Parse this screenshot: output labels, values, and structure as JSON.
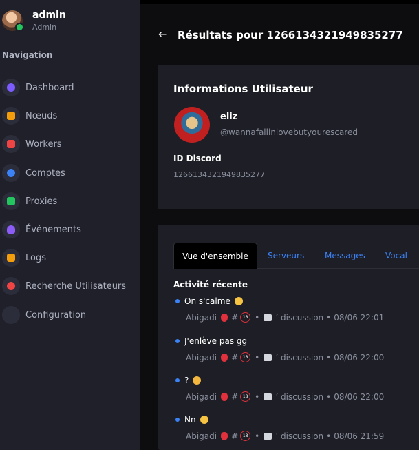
{
  "sidebar": {
    "user": {
      "name": "admin",
      "role": "Admin"
    },
    "section_title": "Navigation",
    "items": [
      {
        "label": "Dashboard",
        "icon": "dashboard-icon",
        "color": "#7c5cff"
      },
      {
        "label": "Nœuds",
        "icon": "server-icon",
        "color": "#f59e0b"
      },
      {
        "label": "Workers",
        "icon": "stack-icon",
        "color": "#ef4444"
      },
      {
        "label": "Comptes",
        "icon": "users-icon",
        "color": "#3b82f6"
      },
      {
        "label": "Proxies",
        "icon": "proxy-icon",
        "color": "#22c55e"
      },
      {
        "label": "Événements",
        "icon": "bell-icon",
        "color": "#8b5cf6"
      },
      {
        "label": "Logs",
        "icon": "log-icon",
        "color": "#f59e0b"
      },
      {
        "label": "Recherche Utilisateurs",
        "icon": "user-search-icon",
        "color": "#ef4444"
      },
      {
        "label": "Configuration",
        "icon": "gear-icon",
        "color": "#2b2d3a"
      }
    ]
  },
  "header": {
    "back_icon": "arrow-left-icon",
    "title": "Résultats pour 1266134321949835277"
  },
  "user_info": {
    "title": "Informations Utilisateur",
    "display_name": "eliz",
    "handle": "@wannafallinlovebutyourescared",
    "id_label": "ID Discord",
    "id_value": "1266134321949835277"
  },
  "tabs": [
    "Vue d'ensemble",
    "Serveurs",
    "Messages",
    "Vocal"
  ],
  "activity": {
    "title": "Activité récente",
    "items": [
      {
        "text": "On s'calme",
        "emoji": "confused-face-icon",
        "server": "Abigadi",
        "channel": "discussion",
        "time": "08/06 22:01"
      },
      {
        "text": "J'enlève pas gg",
        "emoji": "",
        "server": "Abigadi",
        "channel": "discussion",
        "time": "08/06 22:00"
      },
      {
        "text": "?",
        "emoji": "crying-face-icon",
        "server": "Abigadi",
        "channel": "discussion",
        "time": "08/06 22:00"
      },
      {
        "text": "Nn",
        "emoji": "confused-face-icon",
        "server": "Abigadi",
        "channel": "discussion",
        "time": "08/06 21:59"
      }
    ],
    "sep": "•",
    "hash": "#",
    "eighteen": "18"
  }
}
